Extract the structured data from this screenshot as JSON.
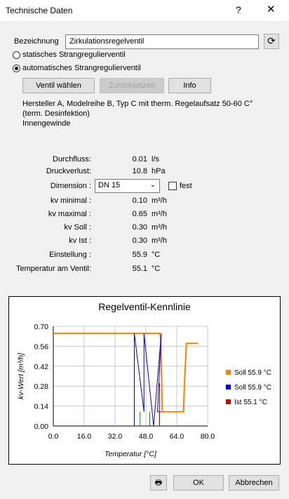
{
  "window": {
    "title": "Technische Daten",
    "help": "?",
    "close": "✕"
  },
  "bezeichnung": {
    "label": "Bezeichnung",
    "value": "Zirkulationsregelventil"
  },
  "radio": {
    "static": "statisches Strangregulierventil",
    "automatic": "automatisches Strangregulierventil",
    "selected": "automatic"
  },
  "buttons": {
    "choose": "Ventil wählen",
    "reset": "Zurücksetzen",
    "info": "Info",
    "ok": "OK",
    "cancel": "Abbrechen"
  },
  "description": {
    "line1": "Hersteller A, Modelreihe B, Typ C mit therm. Regelaufsatz 50-60 C°",
    "line2": "(term. Desinfektion)",
    "line3": "Innengewinde"
  },
  "values": [
    {
      "label": "Durchfluss:",
      "value": "0.01",
      "unit": "l/s"
    },
    {
      "label": "Druckverlust:",
      "value": "10.8",
      "unit": "hPa"
    },
    {
      "label": "kv minimal :",
      "value": "0.10",
      "unit": "m³/h"
    },
    {
      "label": "kv maximal :",
      "value": "0.65",
      "unit": "m³/h"
    },
    {
      "label": "kv Soll :",
      "value": "0.30",
      "unit": "m³/h"
    },
    {
      "label": "kv Ist :",
      "value": "0.30",
      "unit": "m³/h"
    },
    {
      "label": "Einstellung :",
      "value": "55.9",
      "unit": "°C"
    },
    {
      "label": "Temperatur am Ventil:",
      "value": "55.1",
      "unit": "°C"
    }
  ],
  "dimension": {
    "label": "Dimension :",
    "value": "DN 15",
    "fest": "fest"
  },
  "chart_data": {
    "type": "line",
    "title": "Regelventil-Kennlinie",
    "xlabel": "Temperatur [°C]",
    "ylabel": "kv-Wert [m³/h]",
    "xlim": [
      0,
      80
    ],
    "ylim": [
      0,
      0.7
    ],
    "xticks": [
      "0.0",
      "16.0",
      "32.0",
      "48.0",
      "64.0",
      "80.0"
    ],
    "yticks": [
      "0.00",
      "0.14",
      "0.28",
      "0.42",
      "0.56",
      "0.70"
    ],
    "grid": true,
    "legend_position": "right",
    "series": [
      {
        "name": "Soll 55.9 °C",
        "color": "#ff8000",
        "x": [
          0,
          55.3,
          55.8,
          56.5,
          67.5,
          68.0,
          69.0,
          75.0
        ],
        "y": [
          0.65,
          0.65,
          0.58,
          0.1,
          0.1,
          0.3,
          0.58,
          0.58
        ]
      },
      {
        "name": "Soll 55.9 °C",
        "color": "#0000cc",
        "x": [
          42.0,
          42.0,
          47.0,
          47.0,
          52.0,
          56.0,
          54.0,
          56.0
        ],
        "y": [
          0.0,
          0.65,
          0.1,
          0.65,
          0.0,
          0.65,
          0.1,
          0.1
        ]
      },
      {
        "name": "Ist 55.1 °C",
        "color": "#cc0000",
        "x": [
          55.1,
          55.1
        ],
        "y": [
          0.0,
          0.3
        ]
      }
    ],
    "green_markers_x": [
      45,
      50,
      55
    ]
  }
}
